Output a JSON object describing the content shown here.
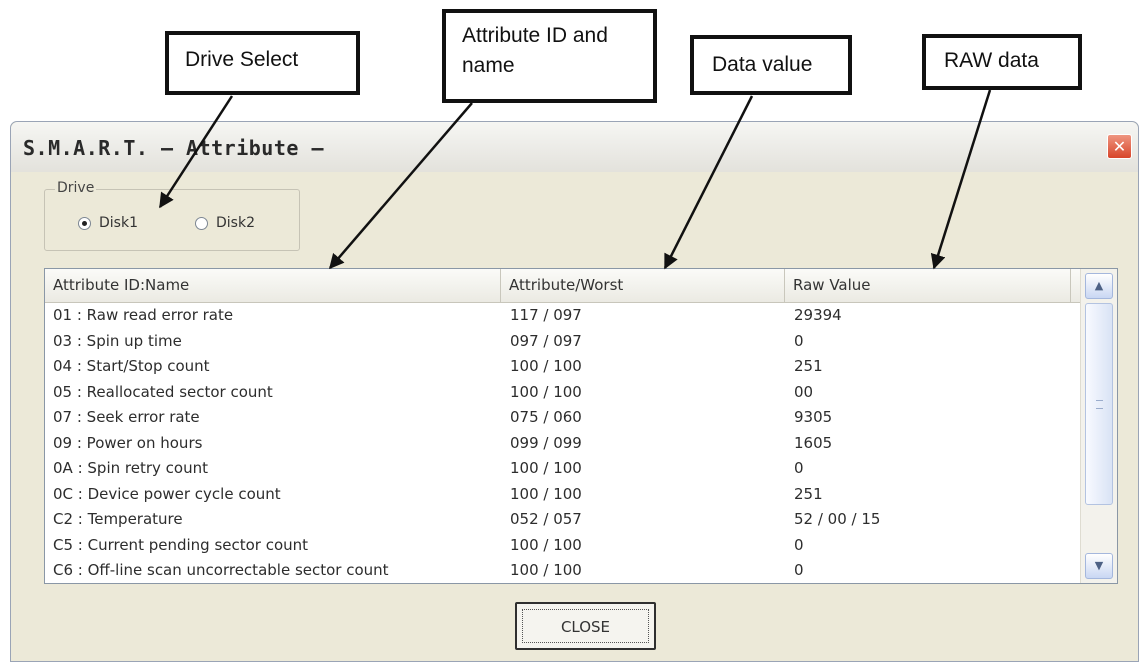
{
  "callouts": {
    "drive_select": "Drive Select",
    "attribute_id_name_line1": "Attribute  ID and",
    "attribute_id_name_line2": "name",
    "data_value": "Data value",
    "raw_data": "RAW data"
  },
  "window": {
    "title": "S.M.A.R.T. – Attribute –",
    "close_glyph": "✕"
  },
  "drive_group": {
    "legend": "Drive",
    "options": [
      {
        "label": "Disk1",
        "selected": true
      },
      {
        "label": "Disk2",
        "selected": false
      }
    ]
  },
  "table": {
    "headers": [
      "Attribute ID:Name",
      "Attribute/Worst",
      "Raw Value"
    ],
    "rows": [
      [
        "01 : Raw read error rate",
        "117 / 097",
        "29394"
      ],
      [
        "03 : Spin up time",
        "097 / 097",
        "0"
      ],
      [
        "04 : Start/Stop count",
        "100 / 100",
        "251"
      ],
      [
        "05 : Reallocated sector count",
        "100 / 100",
        "00"
      ],
      [
        "07 : Seek error rate",
        "075 / 060",
        "9305"
      ],
      [
        "09 : Power on hours",
        "099 / 099",
        "1605"
      ],
      [
        "0A : Spin retry count",
        "100 / 100",
        "0"
      ],
      [
        "0C : Device power cycle count",
        "100 / 100",
        "251"
      ],
      [
        "C2 : Temperature",
        "052 / 057",
        "52 / 00 / 15"
      ],
      [
        "C5 : Current pending sector count",
        "100 / 100",
        "0"
      ],
      [
        "C6 : Off-line scan uncorrectable sector count",
        "100 / 100",
        "0"
      ]
    ]
  },
  "scrollbar": {
    "up_icon": "▲",
    "down_icon": "▼"
  },
  "buttons": {
    "close_label": "CLOSE"
  }
}
